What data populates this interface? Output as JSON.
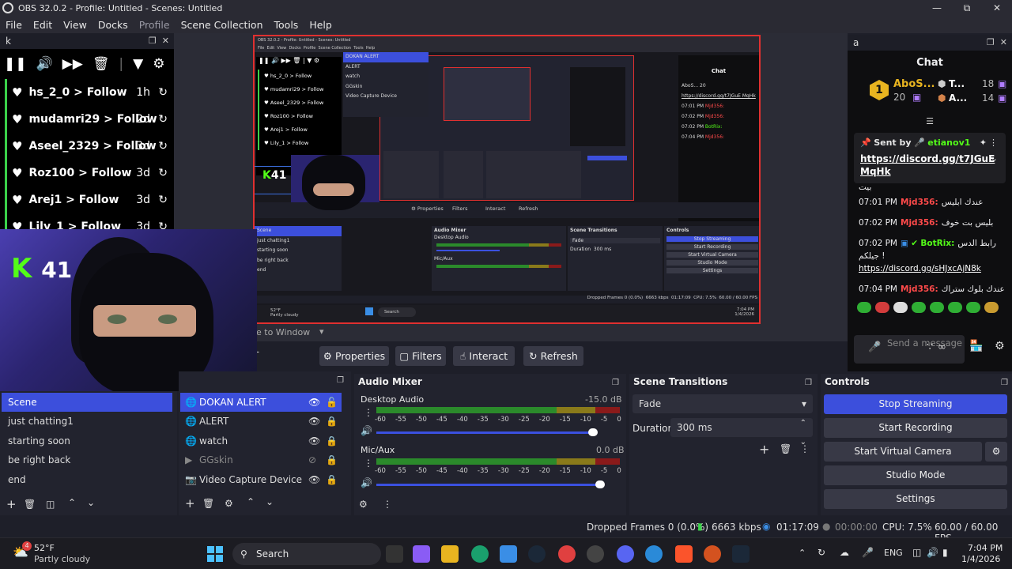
{
  "window": {
    "title": "OBS 32.0.2 - Profile: Untitled - Scenes: Untitled",
    "controls": [
      "minimize-icon",
      "maximize-icon",
      "close-icon"
    ]
  },
  "menu": [
    "File",
    "Edit",
    "View",
    "Docks",
    "Profile",
    "Scene Collection",
    "Tools",
    "Help"
  ],
  "activity_dock": {
    "title": "k",
    "items": [
      {
        "user": "hs_2_0",
        "action": "Follow",
        "time": "1h"
      },
      {
        "user": "mudamri29",
        "action": "Follow",
        "time": "2d"
      },
      {
        "user": "Aseel_2329",
        "action": "Follow",
        "time": "3d"
      },
      {
        "user": "Roz100",
        "action": "Follow",
        "time": "3d"
      },
      {
        "user": "Arej1",
        "action": "Follow",
        "time": "3d"
      },
      {
        "user": "Lily_1",
        "action": "Follow",
        "time": "3d"
      }
    ]
  },
  "webcam": {
    "kick_badge": "K",
    "viewer_count": "41"
  },
  "chat_dock": {
    "title": "a",
    "header": "Chat",
    "leaderboard": [
      {
        "rank": "1",
        "name": "AboS...",
        "count": "20"
      },
      {
        "name": "T...",
        "count": "18"
      },
      {
        "name": "A...",
        "count": "14"
      }
    ],
    "pinned": {
      "label": "Sent by",
      "user": "etianov1",
      "link": "https://discord.gg/t7JGuE MqHk"
    },
    "partial_line": "بيت",
    "messages": [
      {
        "time": "07:01 PM",
        "user": "Mjd356:",
        "text": "عندك ابليس"
      },
      {
        "time": "07:02 PM",
        "user": "Mjd356:",
        "text": "بليس بت خوف"
      },
      {
        "time": "07:02 PM",
        "user": "BotRix:",
        "text": "رابط الدس جيلكم !",
        "link": "https://discord.gg/sHJxcAjN8k"
      },
      {
        "time": "07:04 PM",
        "user": "Mjd356:",
        "text": "عندك بلوك ستراك"
      }
    ],
    "input_placeholder": "Send a message"
  },
  "transform": {
    "text": "e to Window"
  },
  "source_toolbar": {
    "buttons": [
      "Properties",
      "Filters",
      "Interact",
      "Refresh"
    ],
    "left_text": "T"
  },
  "scenes": {
    "items": [
      "Scene",
      "just chatting1",
      "starting soon",
      "be right back",
      "end"
    ],
    "selected": 0
  },
  "sources": {
    "items": [
      {
        "name": "DOKAN ALERT",
        "icon": "browser-icon",
        "visible": true,
        "locked": false
      },
      {
        "name": "ALERT",
        "icon": "browser-icon",
        "visible": true,
        "locked": true
      },
      {
        "name": "watch",
        "icon": "browser-icon",
        "visible": true,
        "locked": true
      },
      {
        "name": "GGskin",
        "icon": "play-icon",
        "visible": false,
        "locked": true
      },
      {
        "name": "Video Capture Device",
        "icon": "camera-icon",
        "visible": true,
        "locked": true
      }
    ],
    "selected": 0
  },
  "audio_mixer": {
    "title": "Audio Mixer",
    "channels": [
      {
        "name": "Desktop Audio",
        "db": "-15.0 dB",
        "level": 0.89
      },
      {
        "name": "Mic/Aux",
        "db": "0.0 dB",
        "level": 0.92
      }
    ],
    "scale": [
      "-60",
      "-55",
      "-50",
      "-45",
      "-40",
      "-35",
      "-30",
      "-25",
      "-20",
      "-15",
      "-10",
      "-5",
      "0"
    ]
  },
  "scene_transitions": {
    "title": "Scene Transitions",
    "transition": "Fade",
    "duration_label": "Duration",
    "duration": "300 ms"
  },
  "controls": {
    "title": "Controls",
    "buttons": [
      "Stop Streaming",
      "Start Recording",
      "Start Virtual Camera",
      "Studio Mode",
      "Settings"
    ]
  },
  "status": {
    "dropped": "Dropped Frames 0 (0.0%)",
    "kbps": "6663 kbps",
    "stream_time": "01:17:09",
    "rec_time": "00:00:00",
    "cpu": "CPU: 7.5%",
    "fps": "60.00 / 60.00 FPS"
  },
  "taskbar": {
    "weather_temp": "52°F",
    "weather_desc": "Partly cloudy",
    "weather_badge": "4",
    "search": "Search",
    "lang": "ENG",
    "time": "7:04 PM",
    "date": "1/4/2026"
  },
  "colors": {
    "accent": "#3c4fdc",
    "kick_green": "#53fc18",
    "live_red": "#e03030"
  }
}
